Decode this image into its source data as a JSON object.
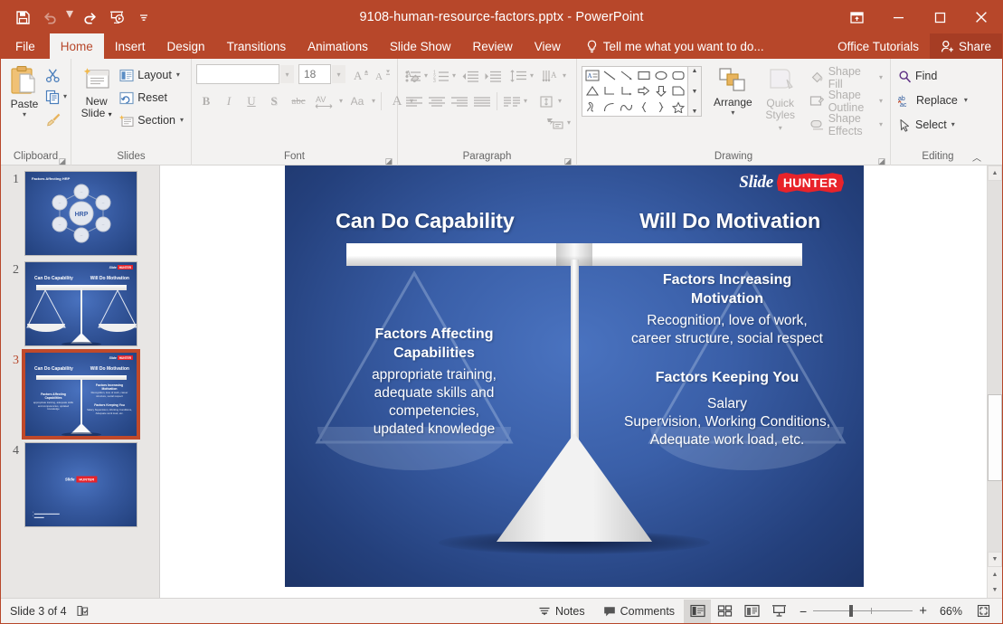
{
  "window": {
    "title": "9108-human-resource-factors.pptx - PowerPoint",
    "quick_access": [
      {
        "name": "save-icon",
        "label": "Save"
      },
      {
        "name": "undo-icon",
        "label": "Undo"
      },
      {
        "name": "redo-icon",
        "label": "Redo"
      },
      {
        "name": "start-presentation-icon",
        "label": "Start From Beginning"
      },
      {
        "name": "customize-qat-icon",
        "label": "Customize Quick Access Toolbar"
      }
    ],
    "controls": [
      {
        "name": "ribbon-display-options",
        "label": "Ribbon Display Options"
      },
      {
        "name": "minimize",
        "label": "Minimize"
      },
      {
        "name": "restore",
        "label": "Restore Down"
      },
      {
        "name": "close",
        "label": "Close"
      }
    ]
  },
  "tabs": {
    "items": [
      "File",
      "Home",
      "Insert",
      "Design",
      "Transitions",
      "Animations",
      "Slide Show",
      "Review",
      "View"
    ],
    "active": "Home",
    "tell_me": "Tell me what you want to do...",
    "office_tutorials": "Office Tutorials",
    "share": "Share"
  },
  "ribbon": {
    "clipboard": {
      "label": "Clipboard",
      "paste": "Paste",
      "cut": "Cut",
      "copy": "Copy",
      "format_painter": "Format Painter"
    },
    "slides": {
      "label": "Slides",
      "new_slide": "New\nSlide",
      "new_slide_line1": "New",
      "new_slide_line2": "Slide",
      "layout": "Layout",
      "reset": "Reset",
      "section": "Section"
    },
    "font": {
      "label": "Font",
      "font_name": "",
      "font_name_placeholder": "",
      "font_size": "18",
      "increase": "A",
      "decrease": "A",
      "clear_formatting": "Clear All Formatting",
      "bold": "B",
      "italic": "I",
      "underline": "U",
      "shadow": "S",
      "strikethrough": "abc",
      "char_spacing": "AV",
      "change_case": "Aa",
      "font_color": "A"
    },
    "paragraph": {
      "label": "Paragraph"
    },
    "drawing": {
      "label": "Drawing",
      "arrange": "Arrange",
      "quick_styles_line1": "Quick",
      "quick_styles_line2": "Styles",
      "shape_fill": "Shape Fill",
      "shape_outline": "Shape Outline",
      "shape_effects": "Shape Effects"
    },
    "editing": {
      "label": "Editing",
      "find": "Find",
      "replace": "Replace",
      "select": "Select"
    }
  },
  "thumbnails": [
    {
      "number": "1",
      "selected": false,
      "title": "Factors Affecting HRP",
      "kind": "hrp-circle"
    },
    {
      "number": "2",
      "selected": false,
      "title": "Can Do Capability / Will Do Motivation",
      "kind": "scale-blank"
    },
    {
      "number": "3",
      "selected": true,
      "title": "Can Do Capability / Will Do Motivation with text",
      "kind": "scale-text"
    },
    {
      "number": "4",
      "selected": false,
      "title": "Slide Hunter credits",
      "kind": "credits"
    }
  ],
  "slide": {
    "logo": {
      "slide": "Slide",
      "hunter": "HUNTER"
    },
    "heading_left": "Can Do Capability",
    "heading_right": "Will Do Motivation",
    "left_block": {
      "heading": "Factors Affecting Capabilities",
      "body": "appropriate training, adequate skills and competencies, updated knowledge",
      "heading_lines": [
        "Factors Affecting",
        "Capabilities"
      ],
      "body_lines": [
        "appropriate training,",
        "adequate skills and",
        "competencies,",
        "updated knowledge"
      ]
    },
    "right_block_1": {
      "heading_lines": [
        "Factors Increasing",
        "Motivation"
      ],
      "body_lines": [
        "Recognition, love of work,",
        "career structure, social respect"
      ]
    },
    "right_block_2": {
      "heading_lines": [
        "Factors Keeping You"
      ],
      "body_lines": [
        "Salary",
        "Supervision, Working Conditions,",
        "Adequate work load, etc."
      ]
    }
  },
  "statusbar": {
    "slide_counter": "Slide 3 of 4",
    "accessibility": "Accessibility Checker",
    "notes": "Notes",
    "comments": "Comments",
    "views": [
      {
        "name": "normal-view",
        "label": "Normal",
        "active": true
      },
      {
        "name": "slide-sorter-view",
        "label": "Slide Sorter",
        "active": false
      },
      {
        "name": "reading-view",
        "label": "Reading View",
        "active": false
      },
      {
        "name": "slide-show-view",
        "label": "Slide Show",
        "active": false
      }
    ],
    "zoom_out": "−",
    "zoom_in": "+",
    "zoom_level": "66%",
    "fit_slide": "Fit slide to current window"
  },
  "colors": {
    "accent": "#b7472a",
    "ribbon_bg": "#f3f2f1",
    "slide_blue": "#3a5fa8",
    "logo_red": "#e8232a"
  }
}
